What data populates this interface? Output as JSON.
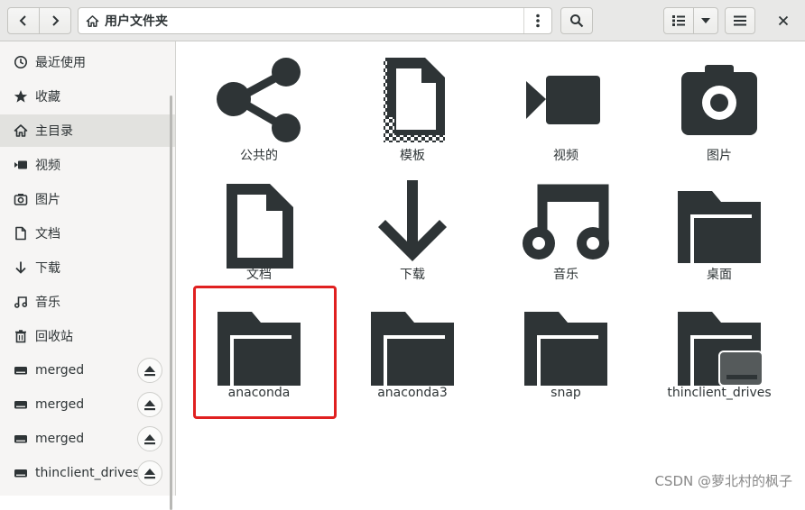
{
  "header": {
    "path_label": "用户文件夹",
    "buttons": {
      "back": "chevron-left-icon",
      "forward": "chevron-right-icon",
      "path_menu": "kebab-menu-icon",
      "search": "search-icon",
      "view_list": "list-view-icon",
      "view_dropdown": "chevron-down-icon",
      "hamburger": "hamburger-menu-icon",
      "close": "close-icon"
    }
  },
  "sidebar": {
    "items": [
      {
        "label": "最近使用",
        "icon": "clock-icon"
      },
      {
        "label": "收藏",
        "icon": "star-icon"
      },
      {
        "label": "主目录",
        "icon": "home-icon",
        "active": true
      },
      {
        "label": "视频",
        "icon": "video-icon"
      },
      {
        "label": "图片",
        "icon": "camera-icon"
      },
      {
        "label": "文档",
        "icon": "document-icon"
      },
      {
        "label": "下载",
        "icon": "download-icon"
      },
      {
        "label": "音乐",
        "icon": "music-icon"
      },
      {
        "label": "回收站",
        "icon": "trash-icon"
      },
      {
        "label": "merged",
        "icon": "drive-icon",
        "eject": true
      },
      {
        "label": "merged",
        "icon": "drive-icon",
        "eject": true
      },
      {
        "label": "merged",
        "icon": "drive-icon",
        "eject": true
      },
      {
        "label": "thinclient_drives",
        "icon": "drive-icon",
        "eject": true
      }
    ]
  },
  "files": [
    {
      "name": "公共的",
      "icon": "share-icon"
    },
    {
      "name": "模板",
      "icon": "template-icon"
    },
    {
      "name": "视频",
      "icon": "video-icon"
    },
    {
      "name": "图片",
      "icon": "camera-icon"
    },
    {
      "name": "文档",
      "icon": "document-icon"
    },
    {
      "name": "下载",
      "icon": "download-icon"
    },
    {
      "name": "音乐",
      "icon": "music-icon"
    },
    {
      "name": "桌面",
      "icon": "folder-icon"
    },
    {
      "name": "anaconda",
      "icon": "folder-icon",
      "highlighted": true
    },
    {
      "name": "anaconda3",
      "icon": "folder-icon"
    },
    {
      "name": "snap",
      "icon": "folder-icon"
    },
    {
      "name": "thinclient_drives",
      "icon": "folder-drive-icon"
    }
  ],
  "watermark": "CSDN @萝北村的枫子",
  "colors": {
    "icon_dark": "#2e3436",
    "highlight_border": "#e02020",
    "sidebar_active": "#e2e2df"
  }
}
